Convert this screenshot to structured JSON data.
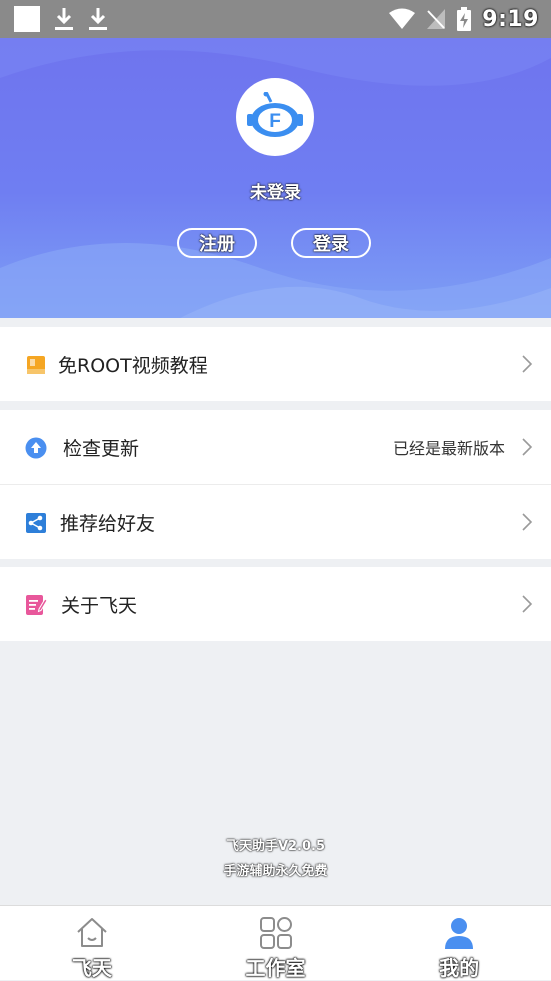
{
  "status_bar": {
    "time": "9:19"
  },
  "profile": {
    "username": "未登录",
    "register_label": "注册",
    "login_label": "登录"
  },
  "menu": {
    "tutorial": {
      "label": "免ROOT视频教程"
    },
    "update": {
      "label": "检查更新",
      "value": "已经是最新版本"
    },
    "share": {
      "label": "推荐给好友"
    },
    "about": {
      "label": "关于飞天"
    }
  },
  "footer": {
    "version": "飞天助手V2.0.5",
    "slogan": "手游辅助永久免费"
  },
  "tabs": [
    {
      "label": "飞天",
      "icon": "home-icon"
    },
    {
      "label": "工作室",
      "icon": "apps-icon"
    },
    {
      "label": "我的",
      "icon": "user-icon",
      "active": true
    }
  ],
  "colors": {
    "header_gradient_top": "#6f74ee",
    "header_gradient_bottom": "#7ea0f5",
    "accent_blue": "#4a8ff0",
    "active_tab": "#4a8ff0"
  }
}
